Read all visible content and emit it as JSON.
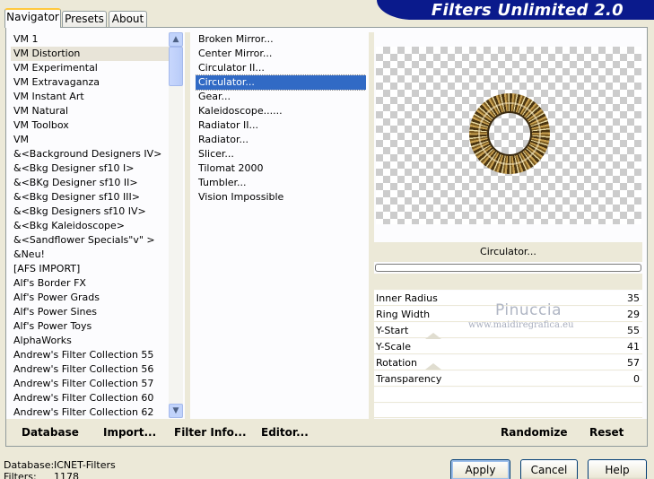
{
  "tabs": [
    {
      "label": "Navigator"
    },
    {
      "label": "Presets"
    },
    {
      "label": "About"
    }
  ],
  "banner": {
    "title": "Filters Unlimited 2.0"
  },
  "categories": {
    "items": [
      "VM 1",
      "VM Distortion",
      "VM Experimental",
      "VM Extravaganza",
      "VM Instant Art",
      "VM Natural",
      "VM Toolbox",
      "VM",
      "&<Background Designers IV>",
      "&<Bkg Designer sf10 I>",
      "&<BKg Designer sf10 II>",
      "&<Bkg Designer sf10 III>",
      "&<Bkg Designers sf10 IV>",
      "&<Bkg Kaleidoscope>",
      "&<Sandflower Specials\"v\" >",
      "&Neu!",
      "[AFS IMPORT]",
      "Alf's Border FX",
      "Alf's Power Grads",
      "Alf's Power Sines",
      "Alf's Power Toys",
      "AlphaWorks",
      "Andrew's Filter Collection 55",
      "Andrew's Filter Collection 56",
      "Andrew's Filter Collection 57",
      "Andrew's Filter Collection 60",
      "Andrew's Filter Collection 62"
    ],
    "selected": "VM Distortion"
  },
  "filters": {
    "items": [
      "Broken Mirror...",
      "Center Mirror...",
      "Circulator II...",
      "Circulator...",
      "Gear...",
      "Kaleidoscope......",
      "Radiator II...",
      "Radiator...",
      "Slicer...",
      "Tilomat 2000",
      "Tumbler...",
      "Vision Impossible"
    ],
    "selected": "Circulator..."
  },
  "preview": {
    "filter_name": "Circulator...",
    "progress": 0
  },
  "params": [
    {
      "label": "Inner Radius",
      "value": "35"
    },
    {
      "label": "Ring Width",
      "value": "29"
    },
    {
      "label": "Y-Start",
      "value": "55"
    },
    {
      "label": "Y-Scale",
      "value": "41"
    },
    {
      "label": "Rotation",
      "value": "57"
    },
    {
      "label": "Transparency",
      "value": "0"
    }
  ],
  "watermark": {
    "name": "Pinuccia",
    "site": "www.maidiregrafica.eu"
  },
  "toolbar": {
    "database": "Database",
    "import": "Import...",
    "filter_info": "Filter Info...",
    "editor": "Editor...",
    "randomize": "Randomize",
    "reset": "Reset"
  },
  "status": {
    "database_label": "Database:",
    "database_value": "ICNET-Filters",
    "filters_label": "Filters:",
    "filters_value": "1178"
  },
  "buttons": {
    "apply": "Apply",
    "cancel": "Cancel",
    "help": "Help"
  },
  "icons": {
    "scroll_up": "chevron-up-icon",
    "scroll_down": "chevron-down-icon"
  },
  "colors": {
    "banner": "#0a1a8c",
    "selection": "#316ac5",
    "window": "#ece9d8"
  }
}
